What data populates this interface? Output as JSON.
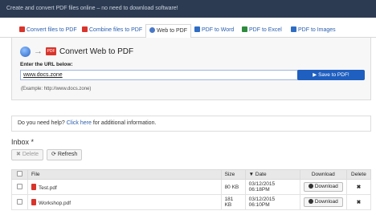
{
  "header": {
    "tagline": "Create and convert PDF files online – no need to download software!"
  },
  "tabs": [
    {
      "label": "Convert files to PDF",
      "icon": "pdf-icon"
    },
    {
      "label": "Combine files to PDF",
      "icon": "pdf-icon"
    },
    {
      "label": "Web to PDF",
      "icon": "globe-icon",
      "active": true
    },
    {
      "label": "PDF to Word",
      "icon": "word-icon"
    },
    {
      "label": "PDF to Excel",
      "icon": "excel-icon"
    },
    {
      "label": "PDF to Images",
      "icon": "image-icon"
    }
  ],
  "panel": {
    "title": "Convert Web to PDF",
    "pdf_badge": "PDF",
    "url_label": "Enter the URL below:",
    "url_value": "www.docs.zone",
    "save_label": "Save to PDF!",
    "example": "(Example: http://www.docs.zone)"
  },
  "help": {
    "prefix": "Do you need help?",
    "link": "Click here",
    "suffix": "for additional information."
  },
  "inbox": {
    "title": "Inbox *",
    "delete_label": "Delete",
    "refresh_label": "Refresh",
    "columns": {
      "file": "File",
      "size": "Size",
      "date": "Date",
      "download": "Download",
      "delete": "Delete"
    },
    "rows": [
      {
        "file": "Test.pdf",
        "size": "80 KB",
        "date": "03/12/2015 06:18PM",
        "download": "Download",
        "delete": "✖"
      },
      {
        "file": "Workshop.pdf",
        "size": "181 KB",
        "date": "03/12/2015 06:10PM",
        "download": "Download",
        "delete": "✖"
      }
    ]
  },
  "colors": {
    "header_bg": "#2d3b52",
    "accent": "#1f5fbf",
    "link": "#2b5fae",
    "pdf_red": "#d9342b"
  }
}
